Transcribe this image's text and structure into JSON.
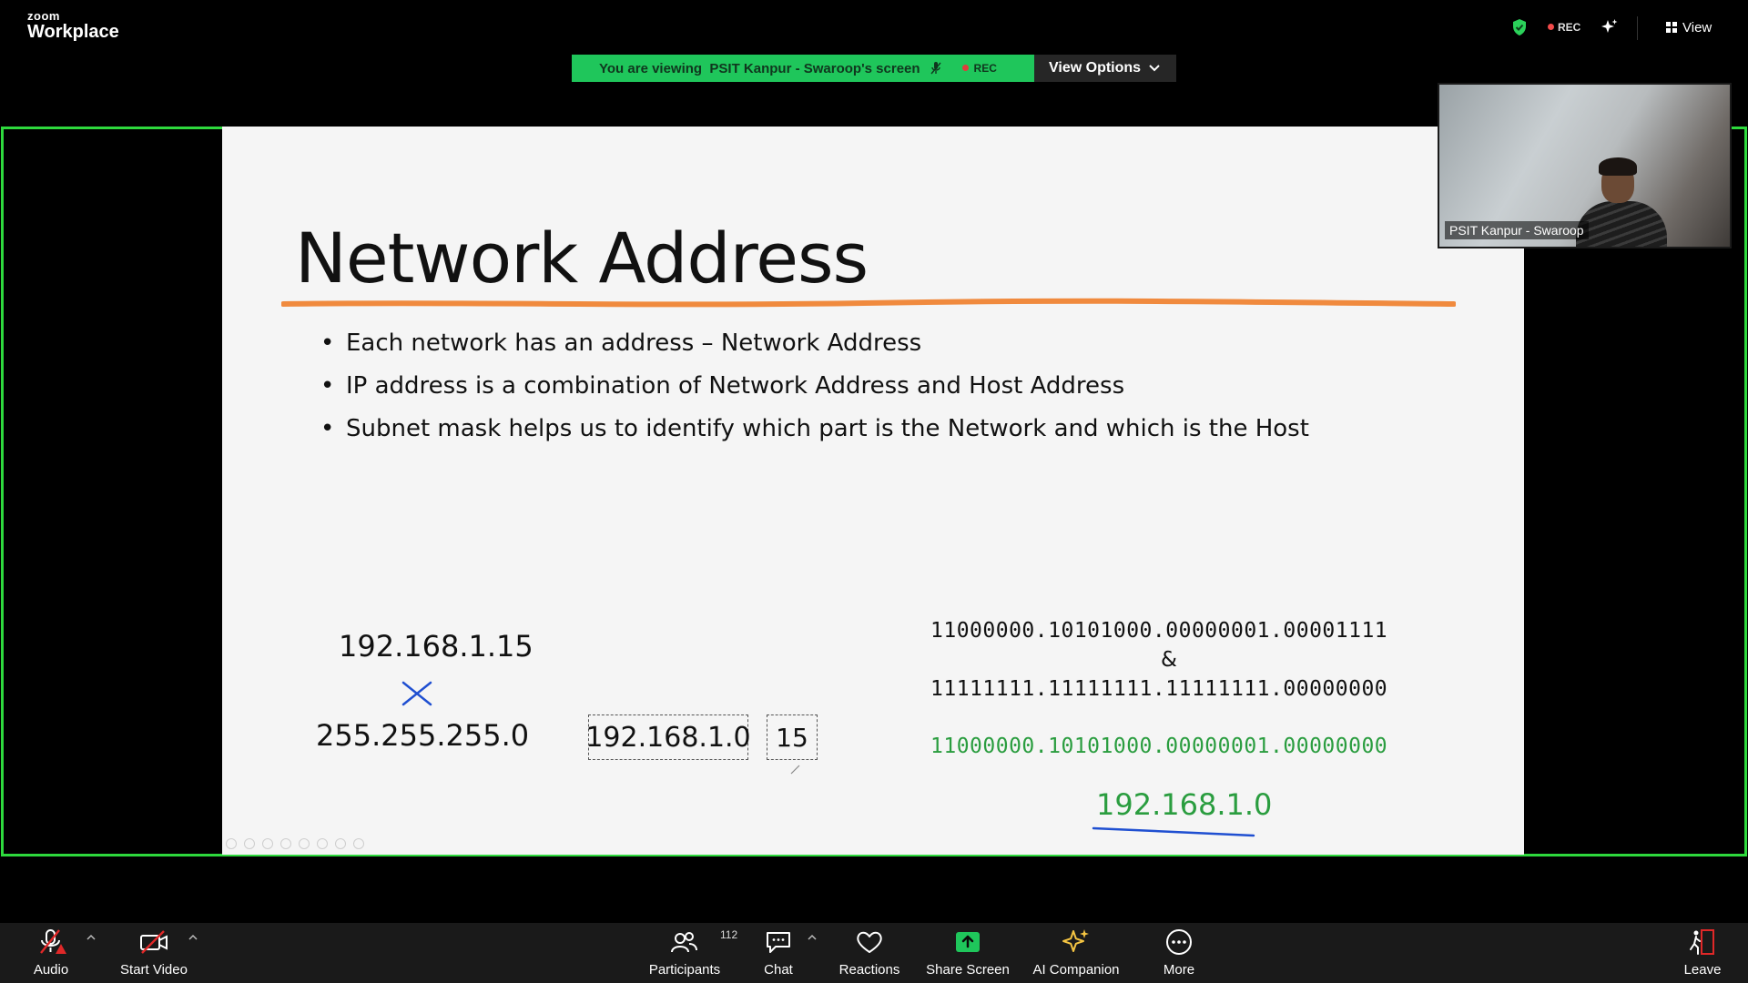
{
  "app": {
    "brand_small": "zoom",
    "brand_big": "Workplace"
  },
  "topbar": {
    "rec_label": "REC",
    "view_label": "View"
  },
  "banner": {
    "viewing_text": "You are viewing  PSIT Kanpur - Swaroop's screen",
    "rec_label": "REC",
    "options_label": "View Options"
  },
  "slide": {
    "title": "Network Address",
    "bullets": [
      "Each network has an address – Network Address",
      "IP address is a combination of Network Address and Host Address",
      "Subnet mask helps us to identify which part is the Network and which is the Host"
    ],
    "ip_handwritten": "192.168.1.15",
    "mask_handwritten": "255.255.255.0",
    "network_box": "192.168.1.0",
    "host_box": "15",
    "binary_ip": "11000000.10101000.00000001.00001111",
    "binary_and": "&",
    "binary_mask": "11111111.11111111.11111111.00000000",
    "binary_result": "11000000.10101000.00000001.00000000",
    "result_handwritten": "192.168.1.0"
  },
  "video": {
    "participant_name": "PSIT Kanpur - Swaroop"
  },
  "toolbar": {
    "audio": "Audio",
    "start_video": "Start Video",
    "participants": "Participants",
    "participants_count": "112",
    "chat": "Chat",
    "reactions": "Reactions",
    "share_screen": "Share Screen",
    "ai_companion": "AI Companion",
    "more": "More",
    "leave": "Leave"
  },
  "colors": {
    "share_border": "#2ed93d",
    "banner_green": "#1fc65b",
    "underline_orange": "#f08a3e",
    "result_green": "#2a9d3f",
    "annotation_blue": "#1f4fd1",
    "rec_red": "#f24b4b"
  }
}
